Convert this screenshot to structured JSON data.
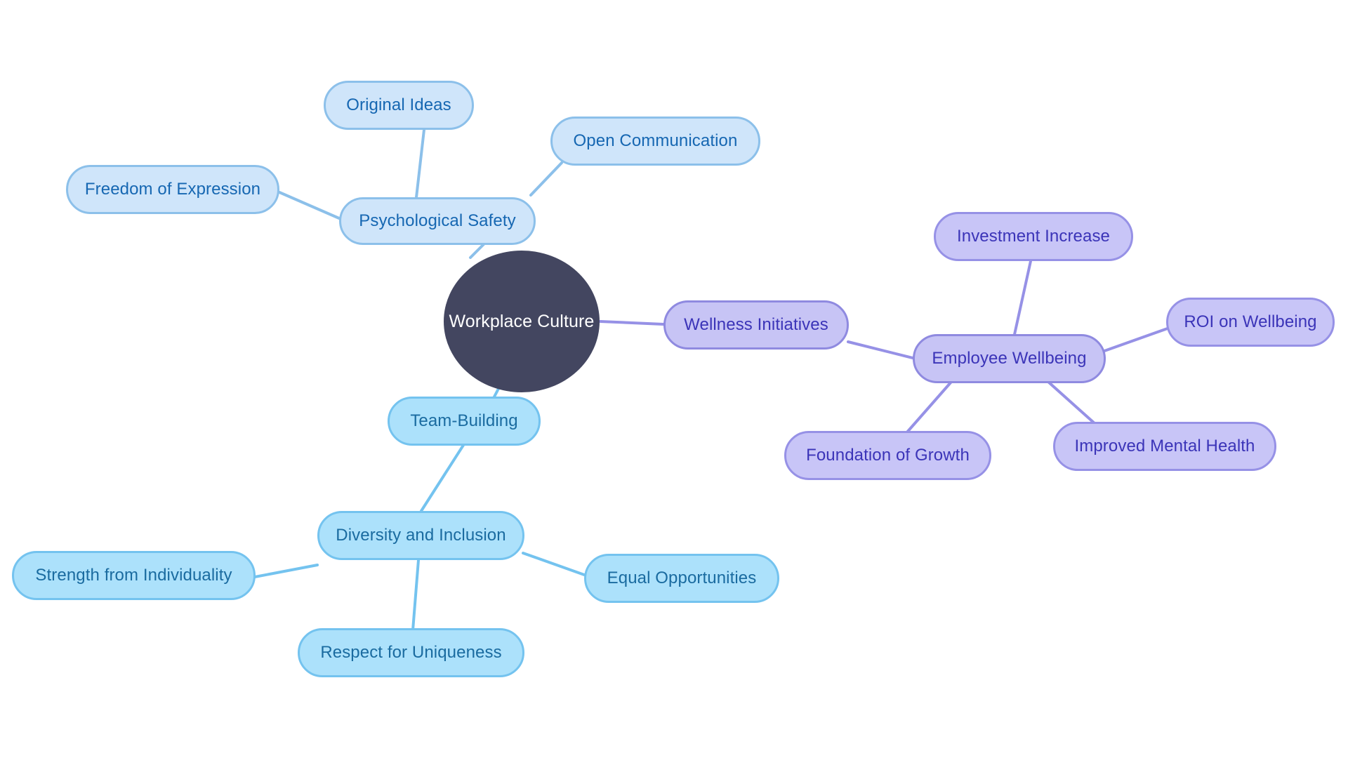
{
  "diagram": {
    "type": "mindmap",
    "title": "Workplace Culture",
    "background": "#ffffff",
    "palette": {
      "root_fill": "#434660",
      "root_text": "#ffffff",
      "blue_branch_fill": "#cfe5fa",
      "blue_branch_border": "#8cc0ea",
      "blue_branch_text": "#1667b2",
      "blue_leaf_fill": "#ace1fb",
      "blue_leaf_border": "#74c3ef",
      "blue_leaf_text": "#1a6ba0",
      "purple_fill": "#c7c4f5",
      "purple_border": "#8f8ae0",
      "purple_text": "#3b34b8",
      "edge_blue": "#8cc0ea",
      "edge_purple": "#9691e6"
    }
  },
  "root": {
    "label": "Workplace Culture"
  },
  "nodes": {
    "psychological_safety": "Psychological Safety",
    "original_ideas": "Original Ideas",
    "open_communication": "Open Communication",
    "freedom_of_expression": "Freedom of Expression",
    "team_building": "Team-Building",
    "diversity_and_inclusion": "Diversity and Inclusion",
    "strength_from_individuality": "Strength from Individuality",
    "respect_for_uniqueness": "Respect for Uniqueness",
    "equal_opportunities": "Equal Opportunities",
    "wellness_initiatives": "Wellness Initiatives",
    "employee_wellbeing": "Employee Wellbeing",
    "investment_increase": "Investment Increase",
    "roi_on_wellbeing": "ROI on Wellbeing",
    "foundation_of_growth": "Foundation of Growth",
    "improved_mental_health": "Improved Mental Health"
  },
  "edges": [
    {
      "from": "root",
      "to": "psychological_safety",
      "color": "#8cc0ea"
    },
    {
      "from": "psychological_safety",
      "to": "original_ideas",
      "color": "#8cc0ea"
    },
    {
      "from": "psychological_safety",
      "to": "open_communication",
      "color": "#8cc0ea"
    },
    {
      "from": "psychological_safety",
      "to": "freedom_of_expression",
      "color": "#8cc0ea"
    },
    {
      "from": "root",
      "to": "team_building",
      "color": "#74c3ef"
    },
    {
      "from": "team_building",
      "to": "diversity_and_inclusion",
      "color": "#74c3ef"
    },
    {
      "from": "diversity_and_inclusion",
      "to": "strength_from_individuality",
      "color": "#74c3ef"
    },
    {
      "from": "diversity_and_inclusion",
      "to": "respect_for_uniqueness",
      "color": "#74c3ef"
    },
    {
      "from": "diversity_and_inclusion",
      "to": "equal_opportunities",
      "color": "#74c3ef"
    },
    {
      "from": "root",
      "to": "wellness_initiatives",
      "color": "#9691e6"
    },
    {
      "from": "wellness_initiatives",
      "to": "employee_wellbeing",
      "color": "#9691e6"
    },
    {
      "from": "employee_wellbeing",
      "to": "investment_increase",
      "color": "#9691e6"
    },
    {
      "from": "employee_wellbeing",
      "to": "roi_on_wellbeing",
      "color": "#9691e6"
    },
    {
      "from": "employee_wellbeing",
      "to": "foundation_of_growth",
      "color": "#9691e6"
    },
    {
      "from": "employee_wellbeing",
      "to": "improved_mental_health",
      "color": "#9691e6"
    }
  ]
}
